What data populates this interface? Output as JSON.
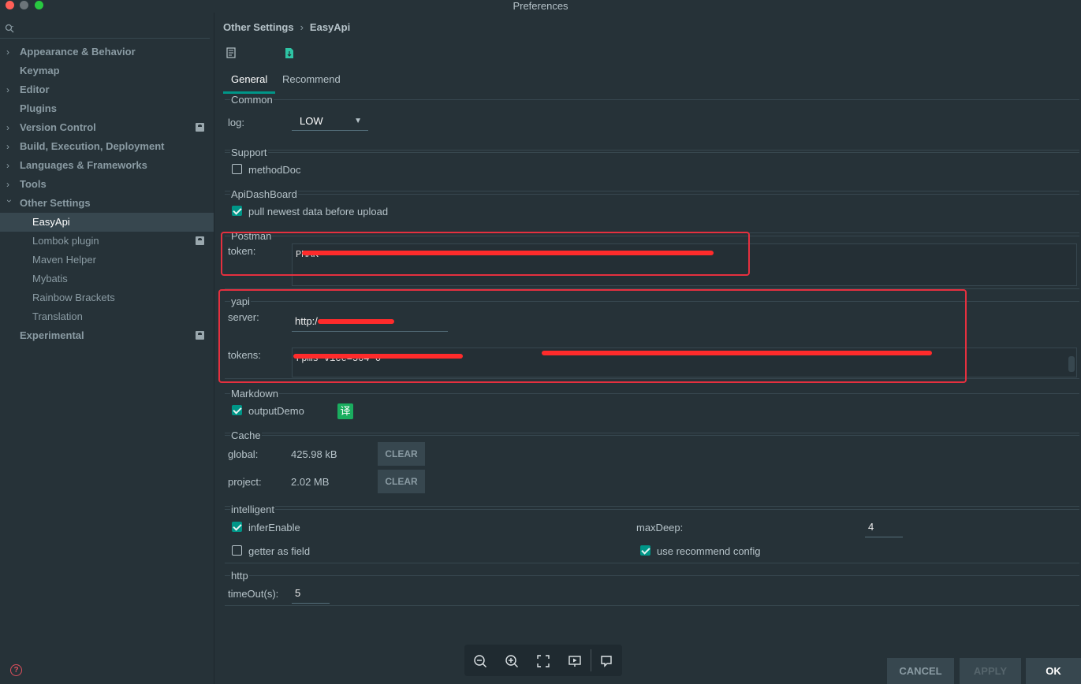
{
  "window": {
    "title": "Preferences"
  },
  "sidebar": {
    "search_placeholder": "",
    "items": [
      {
        "label": "Appearance & Behavior",
        "expandable": true
      },
      {
        "label": "Keymap",
        "expandable": false
      },
      {
        "label": "Editor",
        "expandable": true
      },
      {
        "label": "Plugins",
        "expandable": false
      },
      {
        "label": "Version Control",
        "expandable": true,
        "project": true
      },
      {
        "label": "Build, Execution, Deployment",
        "expandable": true
      },
      {
        "label": "Languages & Frameworks",
        "expandable": true
      },
      {
        "label": "Tools",
        "expandable": true
      },
      {
        "label": "Other Settings",
        "expanded": true
      },
      {
        "label": "EasyApi",
        "child": true,
        "selected": true
      },
      {
        "label": "Lombok plugin",
        "child": true,
        "project": true
      },
      {
        "label": "Maven Helper",
        "child": true
      },
      {
        "label": "Mybatis",
        "child": true
      },
      {
        "label": "Rainbow Brackets",
        "child": true
      },
      {
        "label": "Translation",
        "child": true
      },
      {
        "label": "Experimental",
        "expandable": false,
        "project": true
      }
    ],
    "help_glyph": "?"
  },
  "breadcrumb": {
    "parent": "Other Settings",
    "separator": "›",
    "current": "EasyApi"
  },
  "tabs": [
    {
      "label": "General",
      "active": true
    },
    {
      "label": "Recommend",
      "active": false
    }
  ],
  "common": {
    "title": "Common",
    "log_label": "log:",
    "log_value": "LOW"
  },
  "support": {
    "title": "Support",
    "method_doc": {
      "label": "methodDoc",
      "checked": false
    }
  },
  "api_dashboard": {
    "title": "ApiDashBoard",
    "pull": {
      "label": "pull newest data before upload",
      "checked": true
    }
  },
  "postman": {
    "title": "Postman",
    "token_label": "token:",
    "token_value": "PMAK-"
  },
  "yapi": {
    "title": "yapi",
    "server_label": "server:",
    "server_value": "http:/",
    "tokens_label": "tokens:",
    "tokens_value": "                         rpms      vice=504                                                                    0"
  },
  "markdown": {
    "title": "Markdown",
    "output_demo": {
      "label": "outputDemo",
      "checked": true
    },
    "translate_glyph": "译"
  },
  "cache": {
    "title": "Cache",
    "global_label": "global:",
    "global_value": "425.98 kB",
    "project_label": "project:",
    "project_value": "2.02 MB",
    "clear_label": "CLEAR"
  },
  "intelligent": {
    "title": "intelligent",
    "infer_enable": {
      "label": "inferEnable",
      "checked": true
    },
    "getter_as_field": {
      "label": "getter as field",
      "checked": false
    },
    "max_deep_label": "maxDeep:",
    "max_deep_value": "4",
    "use_recommend": {
      "label": "use recommend config",
      "checked": true
    }
  },
  "http": {
    "title": "http",
    "timeout_label": "timeOut(s):",
    "timeout_value": "5"
  },
  "footer": {
    "cancel": "CANCEL",
    "apply": "APPLY",
    "ok": "OK"
  },
  "zoombar": {
    "icons": [
      "zoom-out-icon",
      "zoom-in-icon",
      "fit-screen-icon",
      "slideshow-icon",
      "comment-icon"
    ]
  },
  "colors": {
    "accent": "#009688",
    "background": "#263238",
    "annotation": "#e5303f"
  }
}
